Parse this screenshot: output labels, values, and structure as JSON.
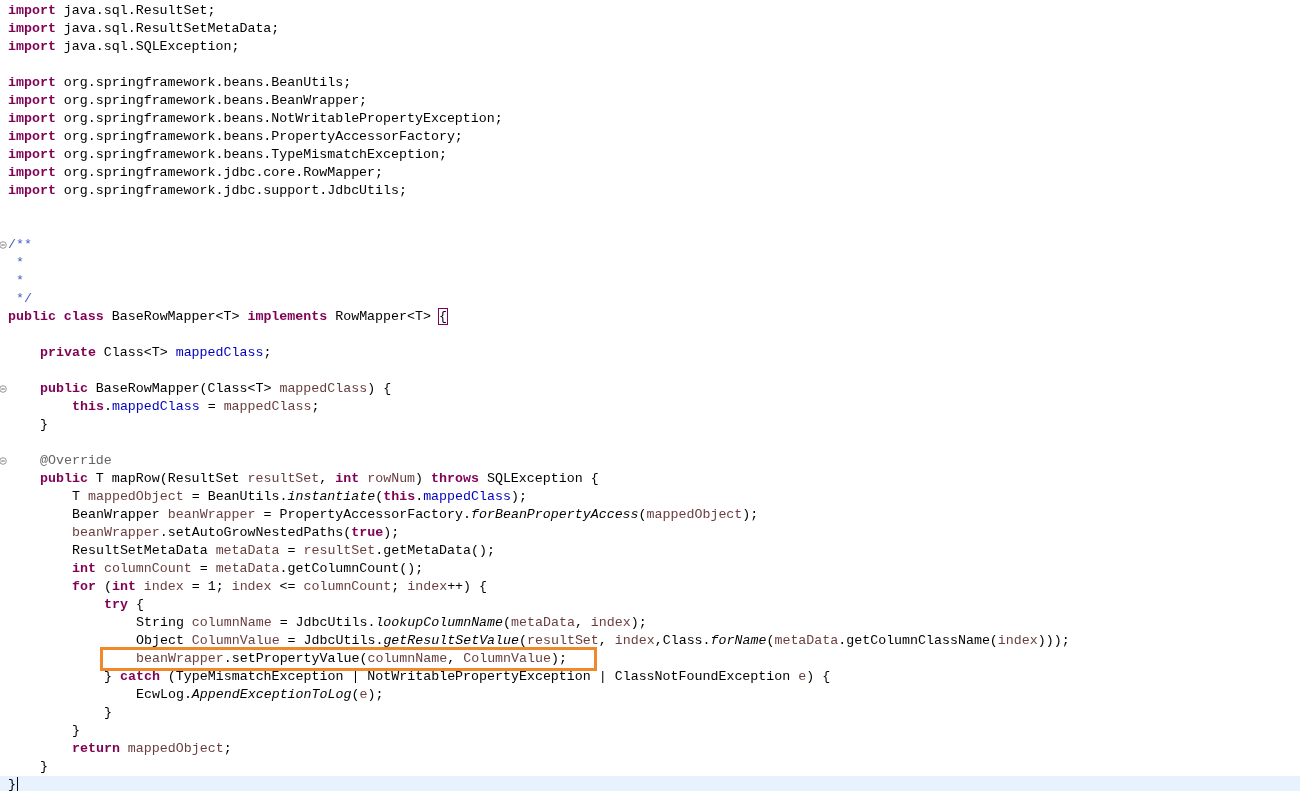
{
  "editor": {
    "lines": [
      {
        "kind": "code",
        "tokens": [
          {
            "text": "import",
            "kind": "kw"
          },
          {
            "text": " java.sql.ResultSet;",
            "kind": "plain"
          }
        ]
      },
      {
        "kind": "code",
        "tokens": [
          {
            "text": "import",
            "kind": "kw"
          },
          {
            "text": " java.sql.ResultSetMetaData;",
            "kind": "plain"
          }
        ]
      },
      {
        "kind": "code",
        "tokens": [
          {
            "text": "import",
            "kind": "kw"
          },
          {
            "text": " java.sql.SQLException;",
            "kind": "plain"
          }
        ]
      },
      {
        "kind": "blank"
      },
      {
        "kind": "code",
        "tokens": [
          {
            "text": "import",
            "kind": "kw"
          },
          {
            "text": " org.springframework.beans.BeanUtils;",
            "kind": "plain"
          }
        ]
      },
      {
        "kind": "code",
        "tokens": [
          {
            "text": "import",
            "kind": "kw"
          },
          {
            "text": " org.springframework.beans.BeanWrapper;",
            "kind": "plain"
          }
        ]
      },
      {
        "kind": "code",
        "tokens": [
          {
            "text": "import",
            "kind": "kw"
          },
          {
            "text": " org.springframework.beans.NotWritablePropertyException;",
            "kind": "plain"
          }
        ]
      },
      {
        "kind": "code",
        "tokens": [
          {
            "text": "import",
            "kind": "kw"
          },
          {
            "text": " org.springframework.beans.PropertyAccessorFactory;",
            "kind": "plain"
          }
        ]
      },
      {
        "kind": "code",
        "tokens": [
          {
            "text": "import",
            "kind": "kw"
          },
          {
            "text": " org.springframework.beans.TypeMismatchException;",
            "kind": "plain"
          }
        ]
      },
      {
        "kind": "code",
        "tokens": [
          {
            "text": "import",
            "kind": "kw"
          },
          {
            "text": " org.springframework.jdbc.core.RowMapper;",
            "kind": "plain"
          }
        ]
      },
      {
        "kind": "code",
        "tokens": [
          {
            "text": "import",
            "kind": "kw"
          },
          {
            "text": " org.springframework.jdbc.support.JdbcUtils;",
            "kind": "plain"
          }
        ]
      },
      {
        "kind": "blank"
      },
      {
        "kind": "blank"
      },
      {
        "kind": "code",
        "foldable": true,
        "tokens": [
          {
            "text": "/**",
            "kind": "comment"
          }
        ]
      },
      {
        "kind": "code",
        "tokens": [
          {
            "text": " *",
            "kind": "comment"
          }
        ]
      },
      {
        "kind": "code",
        "tokens": [
          {
            "text": " *",
            "kind": "comment"
          }
        ]
      },
      {
        "kind": "code",
        "tokens": [
          {
            "text": " */",
            "kind": "comment"
          }
        ]
      },
      {
        "kind": "code",
        "tokens": [
          {
            "text": "public",
            "kind": "kw"
          },
          {
            "text": " class",
            "kind": "kw"
          },
          {
            "text": " BaseRowMapper<T> ",
            "kind": "plain"
          },
          {
            "text": "implements",
            "kind": "kw"
          },
          {
            "text": " RowMapper<T> ",
            "kind": "plain"
          },
          {
            "text": "{",
            "kind": "bracket"
          }
        ]
      },
      {
        "kind": "blank"
      },
      {
        "kind": "code",
        "tokens": [
          {
            "text": "    private",
            "kind": "kw"
          },
          {
            "text": " Class<T> ",
            "kind": "plain"
          },
          {
            "text": "mappedClass",
            "kind": "field"
          },
          {
            "text": ";",
            "kind": "plain"
          }
        ]
      },
      {
        "kind": "blank"
      },
      {
        "kind": "code",
        "foldable": true,
        "tokens": [
          {
            "text": "    public",
            "kind": "kw"
          },
          {
            "text": " BaseRowMapper(Class<T> ",
            "kind": "plain"
          },
          {
            "text": "mappedClass",
            "kind": "var"
          },
          {
            "text": ") {",
            "kind": "plain"
          }
        ]
      },
      {
        "kind": "code",
        "tokens": [
          {
            "text": "        this",
            "kind": "kw"
          },
          {
            "text": ".",
            "kind": "plain"
          },
          {
            "text": "mappedClass",
            "kind": "field"
          },
          {
            "text": " = ",
            "kind": "plain"
          },
          {
            "text": "mappedClass",
            "kind": "var"
          },
          {
            "text": ";",
            "kind": "plain"
          }
        ]
      },
      {
        "kind": "code",
        "tokens": [
          {
            "text": "    }",
            "kind": "plain"
          }
        ]
      },
      {
        "kind": "blank"
      },
      {
        "kind": "code",
        "foldable": true,
        "tokens": [
          {
            "text": "    @Override",
            "kind": "annotation"
          }
        ]
      },
      {
        "kind": "code",
        "tokens": [
          {
            "text": "    public",
            "kind": "kw"
          },
          {
            "text": " T mapRow(ResultSet ",
            "kind": "plain"
          },
          {
            "text": "resultSet",
            "kind": "var"
          },
          {
            "text": ", ",
            "kind": "plain"
          },
          {
            "text": "int",
            "kind": "kw"
          },
          {
            "text": " rowNum",
            "kind": "var"
          },
          {
            "text": ") ",
            "kind": "plain"
          },
          {
            "text": "throws",
            "kind": "kw"
          },
          {
            "text": " SQLException {",
            "kind": "plain"
          }
        ]
      },
      {
        "kind": "code",
        "tokens": [
          {
            "text": "        T ",
            "kind": "plain"
          },
          {
            "text": "mappedObject",
            "kind": "var"
          },
          {
            "text": " = BeanUtils.",
            "kind": "plain"
          },
          {
            "text": "instantiate",
            "kind": "static"
          },
          {
            "text": "(",
            "kind": "plain"
          },
          {
            "text": "this",
            "kind": "kw"
          },
          {
            "text": ".",
            "kind": "plain"
          },
          {
            "text": "mappedClass",
            "kind": "field"
          },
          {
            "text": ");",
            "kind": "plain"
          }
        ]
      },
      {
        "kind": "code",
        "tokens": [
          {
            "text": "        BeanWrapper ",
            "kind": "plain"
          },
          {
            "text": "beanWrapper",
            "kind": "var"
          },
          {
            "text": " = PropertyAccessorFactory.",
            "kind": "plain"
          },
          {
            "text": "forBeanPropertyAccess",
            "kind": "static"
          },
          {
            "text": "(",
            "kind": "plain"
          },
          {
            "text": "mappedObject",
            "kind": "var"
          },
          {
            "text": ");",
            "kind": "plain"
          }
        ]
      },
      {
        "kind": "code",
        "tokens": [
          {
            "text": "        beanWrapper",
            "kind": "var"
          },
          {
            "text": ".setAutoGrowNestedPaths(",
            "kind": "plain"
          },
          {
            "text": "true",
            "kind": "kw"
          },
          {
            "text": ");",
            "kind": "plain"
          }
        ]
      },
      {
        "kind": "code",
        "tokens": [
          {
            "text": "        ResultSetMetaData ",
            "kind": "plain"
          },
          {
            "text": "metaData",
            "kind": "var"
          },
          {
            "text": " = ",
            "kind": "plain"
          },
          {
            "text": "resultSet",
            "kind": "var"
          },
          {
            "text": ".getMetaData();",
            "kind": "plain"
          }
        ]
      },
      {
        "kind": "code",
        "tokens": [
          {
            "text": "        int",
            "kind": "kw"
          },
          {
            "text": " columnCount",
            "kind": "var"
          },
          {
            "text": " = ",
            "kind": "plain"
          },
          {
            "text": "metaData",
            "kind": "var"
          },
          {
            "text": ".getColumnCount();",
            "kind": "plain"
          }
        ]
      },
      {
        "kind": "code",
        "tokens": [
          {
            "text": "        for",
            "kind": "kw"
          },
          {
            "text": " (",
            "kind": "plain"
          },
          {
            "text": "int",
            "kind": "kw"
          },
          {
            "text": " index",
            "kind": "var"
          },
          {
            "text": " = 1; ",
            "kind": "plain"
          },
          {
            "text": "index",
            "kind": "var"
          },
          {
            "text": " <= ",
            "kind": "plain"
          },
          {
            "text": "columnCount",
            "kind": "var"
          },
          {
            "text": "; ",
            "kind": "plain"
          },
          {
            "text": "index",
            "kind": "var"
          },
          {
            "text": "++) {",
            "kind": "plain"
          }
        ]
      },
      {
        "kind": "code",
        "tokens": [
          {
            "text": "            try",
            "kind": "kw"
          },
          {
            "text": " {",
            "kind": "plain"
          }
        ]
      },
      {
        "kind": "code",
        "tokens": [
          {
            "text": "                String ",
            "kind": "plain"
          },
          {
            "text": "columnName",
            "kind": "var"
          },
          {
            "text": " = JdbcUtils.",
            "kind": "plain"
          },
          {
            "text": "lookupColumnName",
            "kind": "static"
          },
          {
            "text": "(",
            "kind": "plain"
          },
          {
            "text": "metaData",
            "kind": "var"
          },
          {
            "text": ", ",
            "kind": "plain"
          },
          {
            "text": "index",
            "kind": "var"
          },
          {
            "text": ");",
            "kind": "plain"
          }
        ]
      },
      {
        "kind": "code",
        "tokens": [
          {
            "text": "                Object ",
            "kind": "plain"
          },
          {
            "text": "ColumnValue",
            "kind": "var"
          },
          {
            "text": " = JdbcUtils.",
            "kind": "plain"
          },
          {
            "text": "getResultSetValue",
            "kind": "static"
          },
          {
            "text": "(",
            "kind": "plain"
          },
          {
            "text": "resultSet",
            "kind": "var"
          },
          {
            "text": ", ",
            "kind": "plain"
          },
          {
            "text": "index",
            "kind": "var"
          },
          {
            "text": ",Class.",
            "kind": "plain"
          },
          {
            "text": "forName",
            "kind": "static"
          },
          {
            "text": "(",
            "kind": "plain"
          },
          {
            "text": "metaData",
            "kind": "var"
          },
          {
            "text": ".getColumnClassName(",
            "kind": "plain"
          },
          {
            "text": "index",
            "kind": "var"
          },
          {
            "text": ")));",
            "kind": "plain"
          }
        ]
      },
      {
        "kind": "code",
        "highlighted": true,
        "tokens": [
          {
            "text": "                beanWrapper",
            "kind": "var"
          },
          {
            "text": ".setPropertyValue(",
            "kind": "plain"
          },
          {
            "text": "columnName",
            "kind": "var"
          },
          {
            "text": ", ",
            "kind": "plain"
          },
          {
            "text": "ColumnValue",
            "kind": "var"
          },
          {
            "text": ");",
            "kind": "plain"
          }
        ]
      },
      {
        "kind": "code",
        "tokens": [
          {
            "text": "            } ",
            "kind": "plain"
          },
          {
            "text": "catch",
            "kind": "kw"
          },
          {
            "text": " (TypeMismatchException | NotWritablePropertyException | ClassNotFoundException ",
            "kind": "plain"
          },
          {
            "text": "e",
            "kind": "var"
          },
          {
            "text": ") {",
            "kind": "plain"
          }
        ]
      },
      {
        "kind": "code",
        "tokens": [
          {
            "text": "                EcwLog.",
            "kind": "plain"
          },
          {
            "text": "AppendExceptionToLog",
            "kind": "static"
          },
          {
            "text": "(",
            "kind": "plain"
          },
          {
            "text": "e",
            "kind": "var"
          },
          {
            "text": ");",
            "kind": "plain"
          }
        ]
      },
      {
        "kind": "code",
        "tokens": [
          {
            "text": "            }",
            "kind": "plain"
          }
        ]
      },
      {
        "kind": "code",
        "tokens": [
          {
            "text": "        }",
            "kind": "plain"
          }
        ]
      },
      {
        "kind": "code",
        "tokens": [
          {
            "text": "        return",
            "kind": "kw"
          },
          {
            "text": " mappedObject",
            "kind": "var"
          },
          {
            "text": ";",
            "kind": "plain"
          }
        ]
      },
      {
        "kind": "code",
        "tokens": [
          {
            "text": "    }",
            "kind": "plain"
          }
        ]
      },
      {
        "kind": "code",
        "current": true,
        "tokens": [
          {
            "text": "}",
            "kind": "plain"
          }
        ]
      }
    ]
  }
}
